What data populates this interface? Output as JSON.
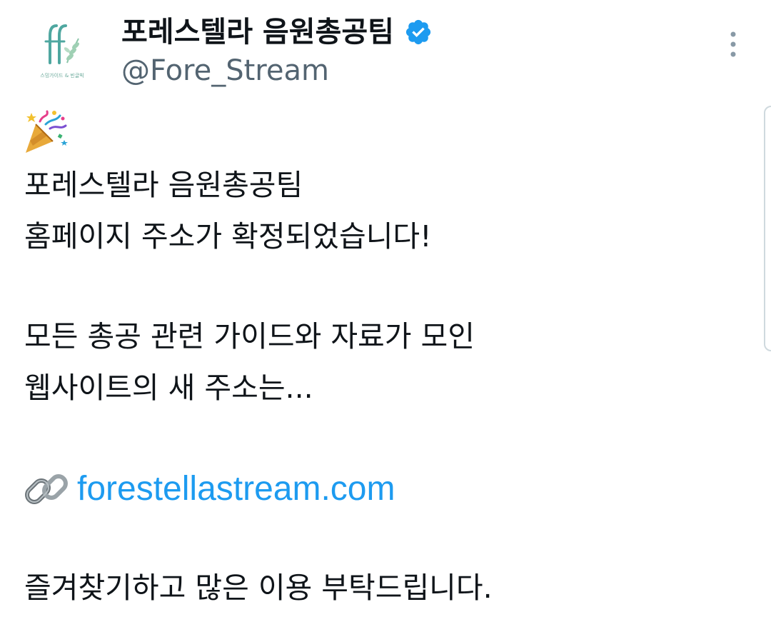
{
  "author": {
    "display_name": "포레스텔라 음원총공팀",
    "handle": "@Fore_Stream",
    "avatar_caption": "스밍가이드 & 빈글빅",
    "verified_icon": "verified-badge-icon",
    "accent_color": "#1d9bf0"
  },
  "post": {
    "emoji_icon": "party-popper-icon",
    "lines": [
      "포레스텔라 음원총공팀",
      "홈페이지 주소가 확정되었습니다!",
      "모든 총공 관련 가이드와 자료가 모인",
      "웹사이트의 새 주소는..."
    ],
    "link_icon": "chain-link-icon",
    "link_text": "forestellastream.com",
    "closing": "즐겨찾기하고 많은 이용 부탁드립니다."
  },
  "menu_icon": "more-vertical-icon"
}
